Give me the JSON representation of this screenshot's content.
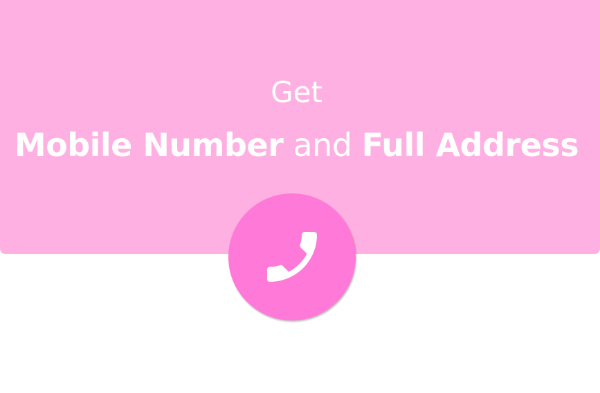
{
  "banner": {
    "heading_line1": "Get",
    "heading_part_bold1": "Mobile Number",
    "heading_part_light": " and ",
    "heading_part_bold2": "Full Address"
  },
  "call_button": {
    "icon": "phone-icon"
  },
  "colors": {
    "banner_bg": "#ffb0e2",
    "circle_bg": "#ff79d8",
    "text": "#ffffff"
  }
}
